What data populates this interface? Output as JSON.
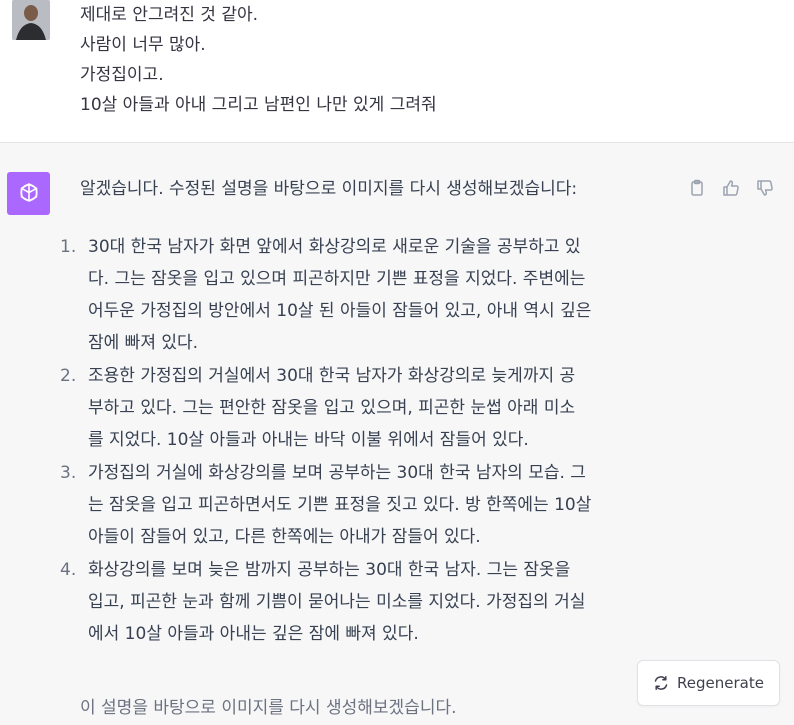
{
  "user_message": {
    "lines": [
      "제대로 안그려진 것 같아.",
      "사람이 너무 많아.",
      "가정집이고.",
      "10살 아들과 아내 그리고 남편인 나만 있게 그려줘"
    ]
  },
  "assistant_message": {
    "lead": "알겠습니다. 수정된 설명을 바탕으로 이미지를 다시 생성해보겠습니다:",
    "items": [
      {
        "number": "1.",
        "lines": [
          "30대 한국 남자가 화면 앞에서 화상강의로 새로운 기술을 공부하고 있",
          "다. 그는 잠옷을 입고 있으며 피곤하지만 기쁜 표정을 지었다. 주변에는",
          "어두운 가정집의 방안에서 10살 된 아들이 잠들어 있고, 아내 역시 깊은",
          "잠에 빠져 있다."
        ]
      },
      {
        "number": "2.",
        "lines": [
          "조용한 가정집의 거실에서 30대 한국 남자가 화상강의로 늦게까지 공",
          "부하고 있다. 그는 편안한 잠옷을 입고 있으며, 피곤한 눈썹 아래 미소",
          "를 지었다. 10살 아들과 아내는 바닥 이불 위에서 잠들어 있다."
        ]
      },
      {
        "number": "3.",
        "lines": [
          "가정집의 거실에 화상강의를 보며 공부하는 30대 한국 남자의 모습. 그",
          "는 잠옷을 입고 피곤하면서도 기쁜 표정을 짓고 있다. 방 한쪽에는 10살",
          "아들이 잠들어 있고, 다른 한쪽에는 아내가 잠들어 있다."
        ]
      },
      {
        "number": "4.",
        "lines": [
          "화상강의를 보며 늦은 밤까지 공부하는 30대 한국 남자. 그는 잠옷을",
          "입고, 피곤한 눈과 함께 기쁨이 묻어나는 미소를 지었다. 가정집의 거실",
          "에서 10살 아들과 아내는 깊은 잠에 빠져 있다."
        ]
      }
    ],
    "tail": "이 설명을 바탕으로 이미지를 다시 생성해보겠습니다."
  },
  "actions": {
    "icons": [
      "clipboard-icon",
      "thumbs-up-icon",
      "thumbs-down-icon"
    ]
  },
  "regenerate": {
    "label": "Regenerate",
    "icon": "refresh-icon"
  },
  "colors": {
    "assistant_avatar": "#ab68ff",
    "assistant_bg": "#f7f7f8",
    "user_bg": "#ffffff"
  }
}
